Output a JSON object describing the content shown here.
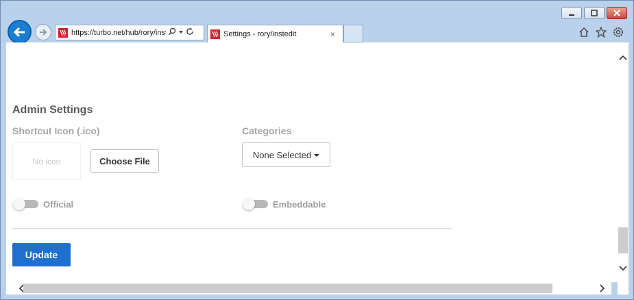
{
  "browser": {
    "url": "https://turbo.net/hub/rory/instedit/settings",
    "tab_title": "Settings - rory/instedit",
    "tab_close": "×",
    "icons": [
      "back-arrow-icon",
      "forward-arrow-icon",
      "search-icon",
      "dropdown-icon",
      "refresh-icon",
      "home-icon",
      "star-icon",
      "gear-icon",
      "minimize-icon",
      "maximize-icon",
      "close-icon"
    ]
  },
  "admin": {
    "title": "Admin Settings",
    "shortcut_label": "Shortcut Icon (.ico)",
    "no_icon_text": "No icon",
    "choose_file": "Choose File",
    "categories_label": "Categories",
    "categories_value": "None Selected",
    "official_label": "Official",
    "official_on": false,
    "embeddable_label": "Embeddable",
    "embeddable_on": false,
    "update_button": "Update"
  },
  "colors": {
    "primary": "#1e6fce",
    "frame": "#b9d1ea",
    "brand_red": "#d3232f"
  }
}
